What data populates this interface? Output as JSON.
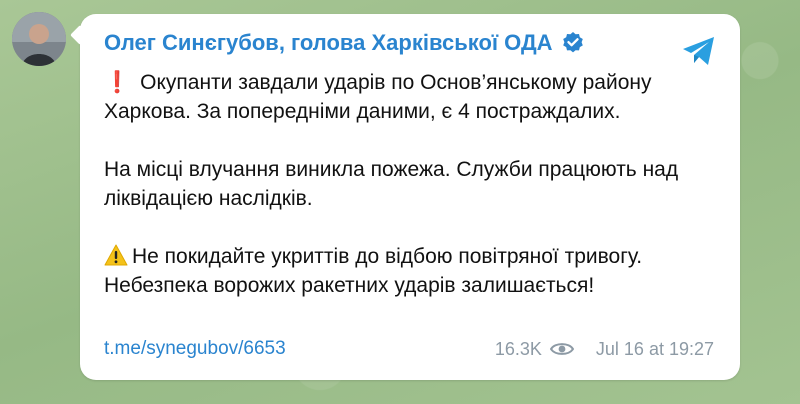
{
  "channel": {
    "name": "Олег Синєгубов, голова Харківської ОДА"
  },
  "message": {
    "paragraphs": [
      {
        "prefix": "❗",
        "text": "Окупанти завдали ударів по Основ’янському району Харкова. За попередніми даними, є 4 постраждалих."
      },
      {
        "prefix": "",
        "text": "На місці влучання виникла пожежа. Служби працюють над ліквідацією наслідків."
      },
      {
        "prefix": "⚠️",
        "text": "Не покидайте укриттів до відбою повітряної тривогу. Небезпека ворожих ракетних ударів залишається!"
      }
    ],
    "link": "t.me/synegubov/6653",
    "views": "16.3K",
    "date": "Jul 16 at 19:27"
  },
  "icons": {
    "verified": "verified-badge-icon",
    "share": "telegram-share-icon",
    "views": "eye-icon"
  },
  "colors": {
    "accent": "#2a84cf",
    "meta": "#8d9aa5",
    "background": "#9fbf8e"
  }
}
